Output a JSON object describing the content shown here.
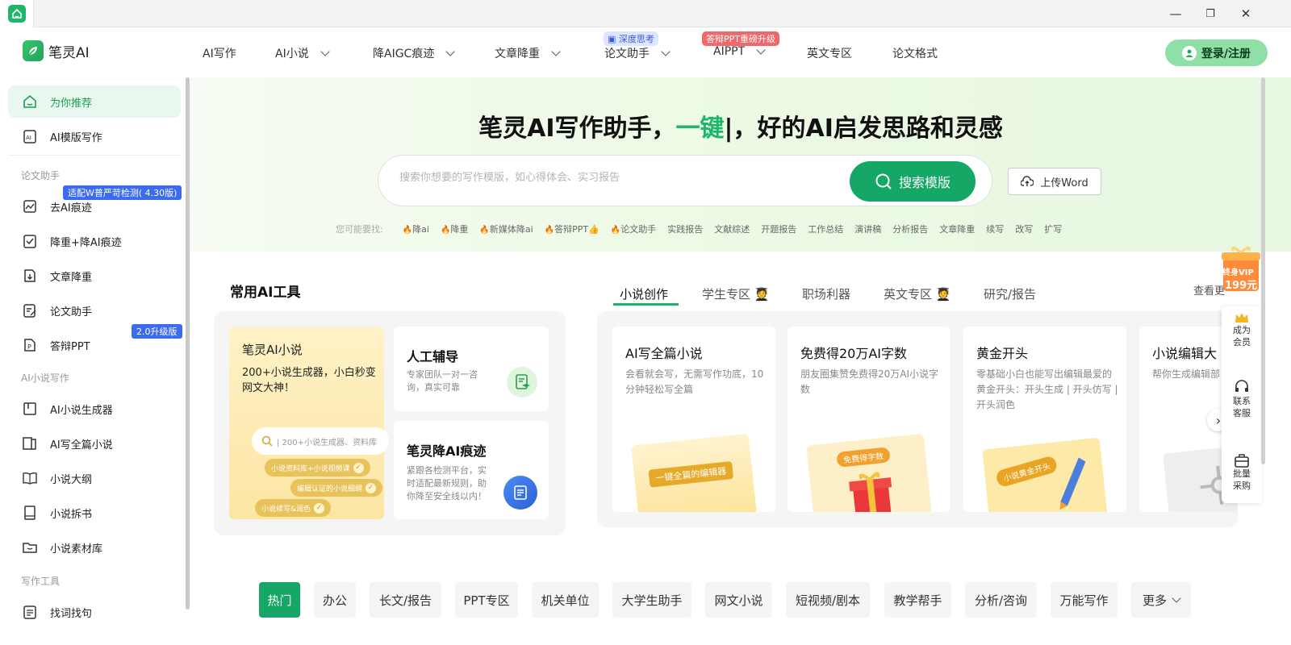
{
  "window": {
    "min": "—",
    "max": "❐",
    "close": "✕"
  },
  "brand": {
    "name": "笔灵AI"
  },
  "nav": {
    "items": [
      "AI写作",
      "AI小说",
      "降AIGC痕迹",
      "文章降重",
      "论文助手",
      "AIPPT",
      "英文专区",
      "论文格式"
    ],
    "badge_deep": "深度思考",
    "badge_ppt": "答辩PPT重磅升级",
    "login": "登录/注册"
  },
  "sidebar": {
    "items": [
      "为你推荐",
      "AI模版写作",
      "去AI痕迹",
      "降重+降AI痕迹",
      "文章降重",
      "论文助手",
      "答辩PPT",
      "AI小说生成器",
      "AI写全篇小说",
      "小说大纲",
      "小说拆书",
      "小说素材库",
      "找词找句"
    ],
    "sections": [
      "论文助手",
      "AI小说写作",
      "写作工具"
    ],
    "badge_ai": "适配W普严苛检测( 4.30版)",
    "badge_ppt": "2.0升级版"
  },
  "hero": {
    "title_a": "笔灵AI写作助手，",
    "title_hl": "一键",
    "title_b": "|，好的AI启发思路和灵感",
    "search_placeholder": "搜索你想要的写作模版，如心得体会、实习报告",
    "search_btn": "搜索模版",
    "upload": "上传Word",
    "hint_label": "您可能要找:",
    "hints_hot": [
      "降ai",
      "降重",
      "新媒体降ai",
      "答辩PPT👍",
      "论文助手"
    ],
    "hints": [
      "实践报告",
      "文献综述",
      "开题报告",
      "工作总结",
      "演讲稿",
      "分析报告",
      "文章降重",
      "续写",
      "改写",
      "扩写"
    ]
  },
  "tools": {
    "title": "常用AI工具",
    "novel_title": "笔灵AI小说",
    "novel_desc": "200+小说生成器，小白秒变网文大神！",
    "mini_search": "| 200+小说生成器、资料库",
    "chips": [
      "小说资料库+小说视频课",
      "编辑认证的小说细纲",
      "小说续写&润色"
    ],
    "human_title": "人工辅导",
    "human_desc": "专家团队一对一咨询，真实可靠",
    "deai_title": "笔灵降AI痕迹",
    "deai_desc": "紧跟各检测平台，实时适配最新规则，助你降至安全线以内！"
  },
  "tabs": {
    "items": [
      "小说创作",
      "学生专区",
      "职场利器",
      "英文专区",
      "研究/报告"
    ],
    "more": "查看更多"
  },
  "cards": [
    {
      "title": "AI写全篇小说",
      "desc": "会看就会写，无需写作功底，10分钟轻松写全篇",
      "art": "一键全篇的编辑器"
    },
    {
      "title": "免费得20万AI字数",
      "desc": "朋友圈集赞免费得20万AI小说字数",
      "art": "免费得字数"
    },
    {
      "title": "黄金开头",
      "desc": "零基础小白也能写出编辑最爱的黄金开头：开头生成 | 开头仿写 | 开头润色",
      "art": "小说黄金开头"
    },
    {
      "title": "小说编辑大",
      "desc": "帮你生成编辑部",
      "art": ""
    }
  ],
  "floating": {
    "vip_a": "终身VIP",
    "vip_b": "199元",
    "member": "成为会员",
    "service": "联系客服",
    "bulk": "批量采购"
  },
  "categories": [
    "热门",
    "办公",
    "长文/报告",
    "PPT专区",
    "机关单位",
    "大学生助手",
    "网文小说",
    "短视频/剧本",
    "教学帮手",
    "分析/咨询",
    "万能写作",
    "更多"
  ],
  "colors": {
    "brand": "#14a765",
    "accent_blue": "#3b6cf0",
    "badge_red": "#f0686a"
  }
}
